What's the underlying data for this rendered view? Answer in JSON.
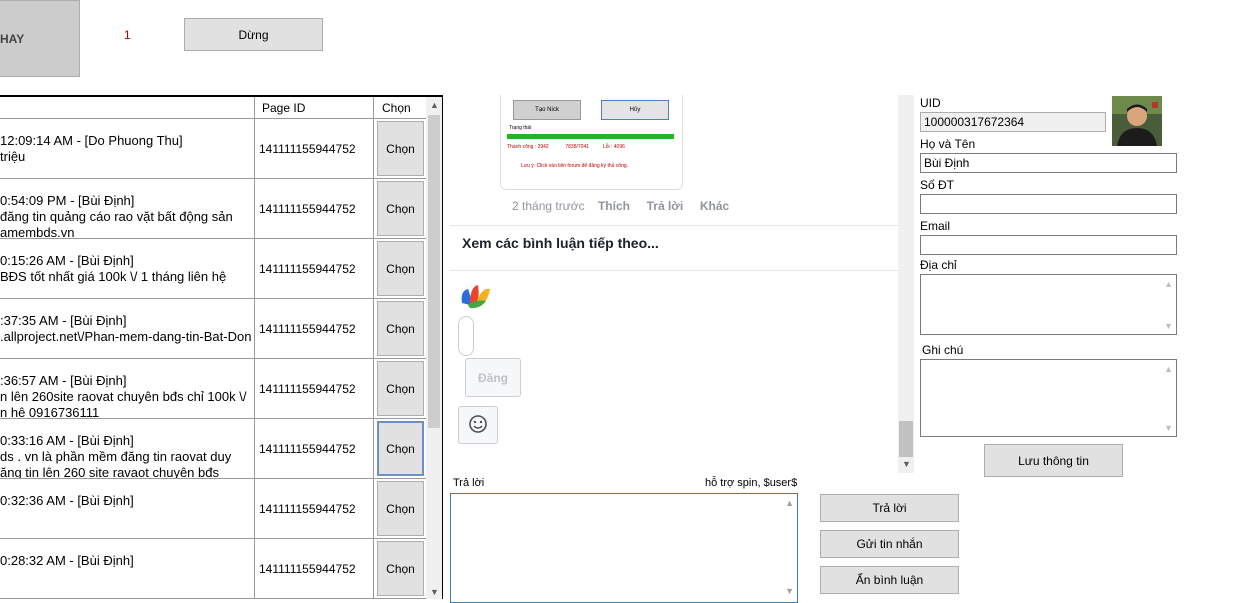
{
  "top": {
    "run_button_label": "HAY",
    "counter": "1",
    "stop_button_label": "Dừng"
  },
  "grid": {
    "columns": [
      "",
      "Page ID",
      "Chọn"
    ],
    "rows": [
      {
        "line1": "12:09:14 AM - [Do Phuong Thu]",
        "line2": "triệu",
        "page_id": "141111155944752",
        "button": "Chọn"
      },
      {
        "line1": "0:54:09 PM - [Bùi Định]",
        "line2": "đăng tin quảng cáo rao vặt bất động sản",
        "line3": "amembds.vn",
        "page_id": "141111155944752",
        "button": "Chọn"
      },
      {
        "line1": "0:15:26 AM - [Bùi Định]",
        "line2": "BĐS tốt nhất giá 100k \\/ 1 tháng liên hệ",
        "page_id": "141111155944752",
        "button": "Chọn"
      },
      {
        "line1": ":37:35 AM - [Bùi Định]",
        "line2": ".allproject.net\\/Phan-mem-dang-tin-Bat-Don",
        "page_id": "141111155944752",
        "button": "Chọn"
      },
      {
        "line1": ":36:57 AM - [Bùi Định]",
        "line2": "n lên 260site raovat chuyên bđs chỉ 100k \\/",
        "line3": "n hệ 0916736111",
        "page_id": "141111155944752",
        "button": "Chọn"
      },
      {
        "line1": "0:33:16 AM - [Bùi Định]",
        "line2": "ds . vn là phần mềm đăng tin raovat duy",
        "line3": "ăng tin lên 260 site ravaot chuyên bđs",
        "page_id": "141111155944752",
        "button": "Chọn"
      },
      {
        "line1": "0:32:36 AM - [Bùi Định]",
        "page_id": "141111155944752",
        "button": "Chọn"
      },
      {
        "line1": "0:28:32 AM - [Bùi Định]",
        "page_id": "141111155944752",
        "button": "Chọn"
      }
    ]
  },
  "web": {
    "preview": {
      "btn_create": "Tạo Nick",
      "btn_cancel": "Hủy",
      "status_label": "Trạng thái",
      "success_label": "Thành công :",
      "success_value": "2942",
      "ratio": "7838/7041",
      "error_label": "Lỗi :",
      "error_value": "4096",
      "note": "Lưu ý: Click vào liên forum để đăng ký thủ công."
    },
    "time_ago": "2 tháng trước",
    "like": "Thích",
    "reply": "Trả lời",
    "other": "Khác",
    "more_comments": "Xem các bình luận tiếp theo...",
    "post_button": "Đăng"
  },
  "profile": {
    "uid_label": "UID",
    "uid_value": "100000317672364",
    "name_label": "Họ và Tên",
    "name_value": "Bùi Định",
    "phone_label": "Số ĐT",
    "phone_value": "",
    "email_label": "Email",
    "email_value": "",
    "address_label": "Địa chỉ",
    "note_label": "Ghi chú",
    "save_label": "Lưu thông tin"
  },
  "reply_panel": {
    "label": "Trả lời",
    "hint": "hỗ trợ spin, $user$",
    "reply_button": "Trả lời",
    "message_button": "Gửi tin nhắn",
    "hide_button": "Ẩn bình luận"
  }
}
